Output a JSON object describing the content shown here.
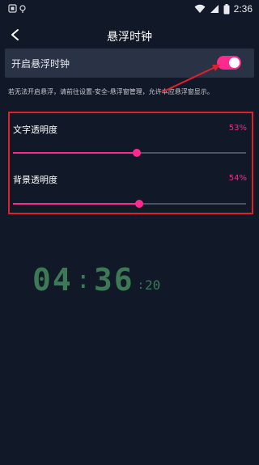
{
  "status_bar": {
    "time": "2:36",
    "left_icons": [
      "notification-icon",
      "pin-icon"
    ],
    "right_icons": [
      "wifi-icon",
      "signal-icon",
      "battery-icon"
    ]
  },
  "app_bar": {
    "title": "悬浮时钟",
    "back_icon": "back-arrow-icon"
  },
  "float_toggle": {
    "label": "开启悬浮时钟",
    "enabled": true,
    "accent_color": "#ff2a8e"
  },
  "hint_text": "若无法开启悬浮，请前往设置-安全-悬浮窗管理，允许本应悬浮窗显示。",
  "sliders": [
    {
      "label": "文字透明度",
      "value_text": "53%",
      "value": 53
    },
    {
      "label": "背景透明度",
      "value_text": "54%",
      "value": 54
    }
  ],
  "clock_preview": {
    "hours": "04",
    "separator": ":",
    "minutes": "36",
    "seconds": "20",
    "color": "#3b7a55"
  },
  "annotation_color": "#e0202a"
}
